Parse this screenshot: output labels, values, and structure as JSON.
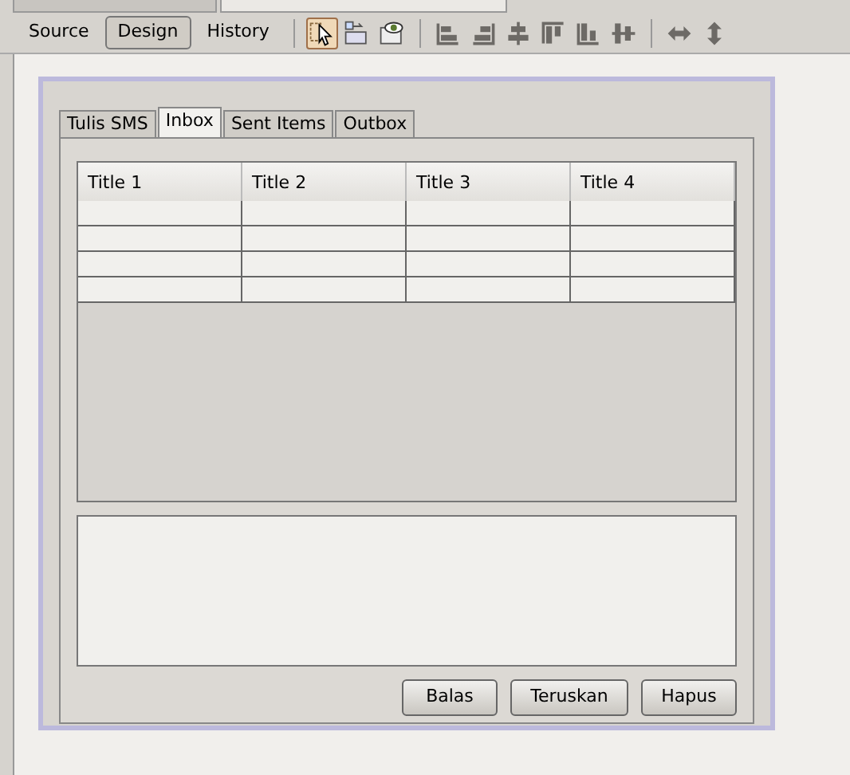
{
  "file_tabs": [
    {
      "selected": false
    },
    {
      "selected": true
    }
  ],
  "view_buttons": [
    {
      "label": "Source",
      "selected": false
    },
    {
      "label": "Design",
      "selected": true
    },
    {
      "label": "History",
      "selected": false
    }
  ],
  "tools": [
    {
      "kind": "select",
      "selected": true
    },
    {
      "kind": "connect",
      "selected": false
    },
    {
      "kind": "preview",
      "selected": false
    },
    {
      "kind": "sep"
    },
    {
      "kind": "align-left",
      "selected": false
    },
    {
      "kind": "align-right",
      "selected": false
    },
    {
      "kind": "center",
      "selected": false
    },
    {
      "kind": "align-top",
      "selected": false
    },
    {
      "kind": "align-bottom",
      "selected": false
    },
    {
      "kind": "middle",
      "selected": false
    },
    {
      "kind": "sep"
    },
    {
      "kind": "resize-h",
      "selected": false
    },
    {
      "kind": "resize-v",
      "selected": false
    }
  ],
  "form": {
    "tabs": [
      {
        "label": "Tulis SMS",
        "selected": false
      },
      {
        "label": "Inbox",
        "selected": true
      },
      {
        "label": "Sent Items",
        "selected": false
      },
      {
        "label": "Outbox",
        "selected": false
      }
    ],
    "table": {
      "columns": [
        "Title 1",
        "Title 2",
        "Title 3",
        "Title 4"
      ]
    },
    "buttons": [
      "Balas",
      "Teruskan",
      "Hapus"
    ]
  }
}
